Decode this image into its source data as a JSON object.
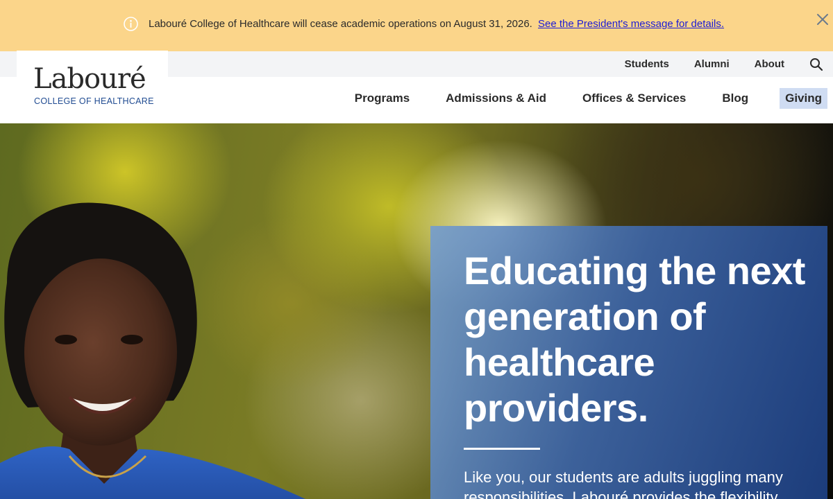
{
  "alert": {
    "message": "Labouré College of Healthcare will cease academic operations on August 31, 2026.",
    "link_text": "See the President's message for details.",
    "info_icon": "info-circle-icon",
    "close_icon": "close-icon"
  },
  "logo": {
    "wordmark": "Labouré",
    "subtitle": "COLLEGE OF HEALTHCARE"
  },
  "utility_nav": {
    "items": [
      "Students",
      "Alumni",
      "About"
    ],
    "search_icon": "search-icon"
  },
  "main_nav": {
    "items": [
      "Programs",
      "Admissions & Aid",
      "Offices & Services",
      "Blog"
    ],
    "giving": "Giving"
  },
  "hero": {
    "title": "Educating the next generation of healthcare providers.",
    "body": "Like you, our students are adults juggling many responsibilities. Labouré provides the flexibility"
  },
  "colors": {
    "alert_bg": "#fbd58a",
    "link": "#1b1bd6",
    "brand_blue": "#214c92",
    "giving_bg": "#cfdcf2"
  }
}
